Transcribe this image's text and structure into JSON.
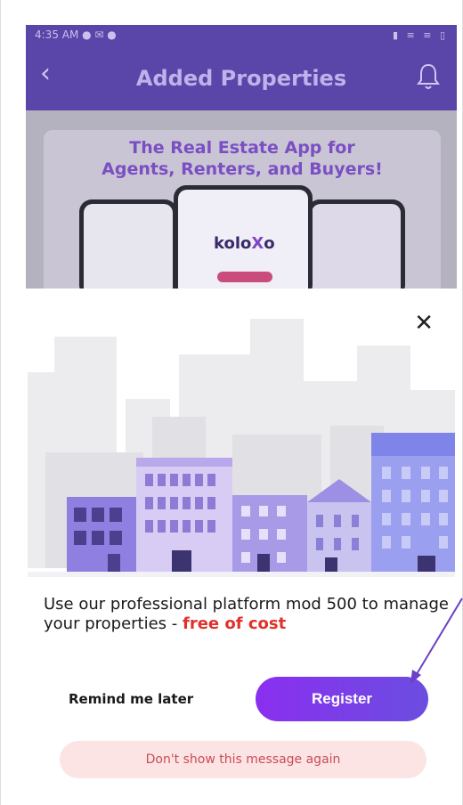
{
  "status_bar": {
    "time": "4:35 AM",
    "left_icons": "● ✉ ●",
    "right_icons": "▮ ≡ ≡ ▯"
  },
  "header": {
    "title": "Added Properties",
    "back_icon": "chevron-left-icon",
    "bell_icon": "bell-icon"
  },
  "banner": {
    "headline_line1": "The Real Estate App for",
    "headline_line2": "Agents, Renters, and Buyers!",
    "brand_prefix": "kolo",
    "brand_x": "X",
    "brand_suffix": "o"
  },
  "modal": {
    "close_icon": "close-icon",
    "promo_text": "Use our professional platform mod 500 to manage your properties  - ",
    "promo_highlight": "free of cost",
    "remind_label": "Remind me later",
    "register_label": "Register",
    "dont_show_label": "Don't show this message again"
  },
  "colors": {
    "header_bg": "#5a45a8",
    "register_gradient_start": "#8a2ff0",
    "register_gradient_end": "#6b4de0",
    "highlight": "#e0312b",
    "dont_bg": "#fde4e4",
    "arrow": "#6b3fc7"
  }
}
